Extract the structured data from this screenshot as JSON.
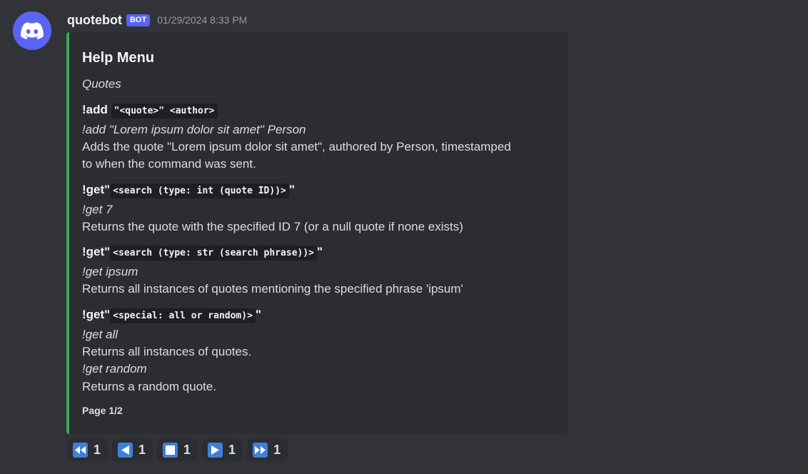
{
  "message": {
    "username": "quotebot",
    "bot_tag": "BOT",
    "timestamp": "01/29/2024 8:33 PM"
  },
  "embed": {
    "accent_color": "#3ba55d",
    "title": "Help Menu",
    "section": "Quotes",
    "commands": [
      {
        "name": "!add",
        "args": "\"<quote>\" <author>",
        "example": "!add \"Lorem ipsum dolor sit amet\" Person",
        "description_line1": "Adds the quote \"Lorem ipsum dolor sit amet\", authored by Person, timestamped",
        "description_line2": "to when the command was sent."
      },
      {
        "name": "!get",
        "quote_open": "\"",
        "args": "<search (type: int (quote ID))>",
        "quote_close": "\"",
        "example": "!get 7",
        "description": "Returns the quote with the specified ID 7 (or a null quote if none exists)"
      },
      {
        "name": "!get",
        "quote_open": "\"",
        "args": "<search (type: str (search phrase))>",
        "quote_close": "\"",
        "example": "!get ipsum",
        "description": "Returns all instances of quotes mentioning the specified phrase 'ipsum'"
      },
      {
        "name": "!get",
        "quote_open": "\"",
        "args": "<special: all or random)>",
        "quote_close": "\"",
        "example1": "!get all",
        "description1": "Returns all instances of quotes.",
        "example2": "!get random",
        "description2": "Returns a random quote."
      }
    ],
    "footer": "Page 1/2"
  },
  "reactions": [
    {
      "icon": "rewind-icon",
      "count": "1"
    },
    {
      "icon": "previous-icon",
      "count": "1"
    },
    {
      "icon": "stop-icon",
      "count": "1"
    },
    {
      "icon": "next-icon",
      "count": "1"
    },
    {
      "icon": "fast-forward-icon",
      "count": "1"
    }
  ]
}
